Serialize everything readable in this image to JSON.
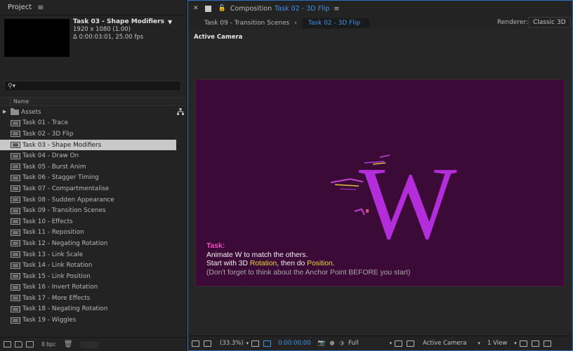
{
  "project_panel": {
    "title": "Project",
    "selected_comp": {
      "name": "Task 03 - Shape Modifiers",
      "resolution": "1920 x 1080 (1.00)",
      "duration": "Δ 0:00:03:01, 25.00 fps"
    },
    "search": {
      "value": "⚲▾",
      "placeholder": ""
    },
    "column_header": "Name",
    "items": [
      {
        "label": "Assets",
        "type": "folder"
      },
      {
        "label": "Task 01 - Trace",
        "type": "comp"
      },
      {
        "label": "Task 02 - 3D Flip",
        "type": "comp"
      },
      {
        "label": "Task 03 - Shape Modifiers",
        "type": "comp",
        "selected": true
      },
      {
        "label": "Task 04 - Draw On",
        "type": "comp"
      },
      {
        "label": "Task 05 - Burst Anim",
        "type": "comp"
      },
      {
        "label": "Task 06 - Stagger Timing",
        "type": "comp"
      },
      {
        "label": "Task 07 - Compartmentalise",
        "type": "comp"
      },
      {
        "label": "Task 08 - Sudden Appearance",
        "type": "comp"
      },
      {
        "label": "Task 09 - Transition Scenes",
        "type": "comp"
      },
      {
        "label": "Task 10 - Effects",
        "type": "comp"
      },
      {
        "label": "Task 11 - Reposition",
        "type": "comp"
      },
      {
        "label": "Task 12 - Negating Rotation",
        "type": "comp"
      },
      {
        "label": "Task 13 - Link Scale",
        "type": "comp"
      },
      {
        "label": "Task 14 - Link Rotation",
        "type": "comp"
      },
      {
        "label": "Task 15 - Link Position",
        "type": "comp"
      },
      {
        "label": "Task 16 - Invert Rotation",
        "type": "comp"
      },
      {
        "label": "Task 17 - More Effects",
        "type": "comp"
      },
      {
        "label": "Task 18 - Negating Rotation",
        "type": "comp"
      },
      {
        "label": "Task 19 - Wiggles",
        "type": "comp"
      }
    ],
    "footer": {
      "bpc": "8 bpc"
    }
  },
  "composition_panel": {
    "prefix": "Composition",
    "comp_name": "Task 02 - 3D Flip",
    "breadcrumb_prev": "Task 09 - Transition Scenes",
    "breadcrumb_current": "Task 02 - 3D Flip",
    "renderer_label": "Renderer:",
    "renderer_value": "Classic 3D",
    "view_label": "Active Camera",
    "canvas": {
      "letter": "W",
      "task_title": "Task:",
      "line1": "Animate W to match the others.",
      "line2_a": "Start with 3D ",
      "line2_b": "Rotation",
      "line2_c": ", then do ",
      "line2_d": "Position",
      "line2_e": ".",
      "line3": "(Don't forget to think about the Anchor Point BEFORE you start)"
    },
    "footer": {
      "zoom": "(33.3%)",
      "timecode": "0:00:00:00",
      "resolution": "Full",
      "camera": "Active Camera",
      "views": "1 View"
    }
  },
  "colors": {
    "accent_blue": "#3f92e6",
    "canvas_bg": "#3b0a36",
    "letter": "#b42ddb",
    "task_title": "#f24bc4",
    "highlight": "#e8de3a"
  }
}
